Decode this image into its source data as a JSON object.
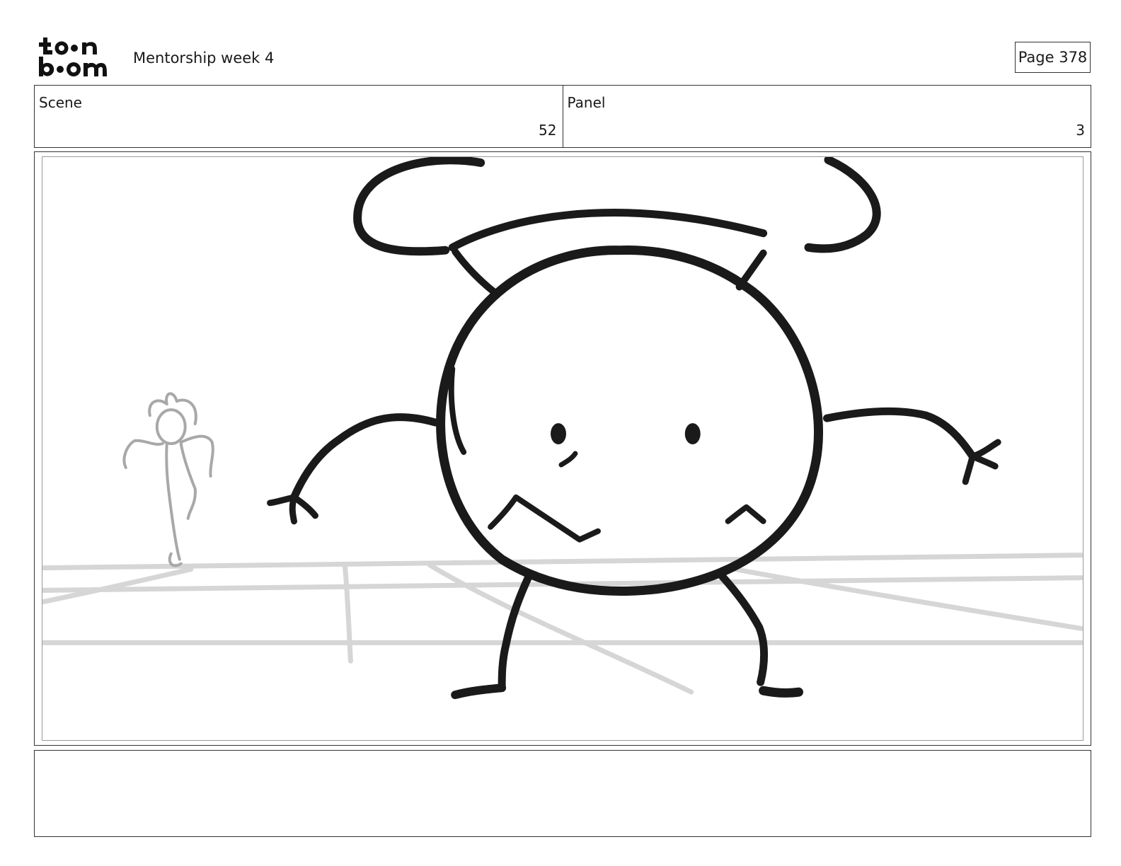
{
  "header": {
    "logo_line1": "to●n",
    "logo_line2": "b●●m",
    "project_title": "Mentorship week 4",
    "page_label": "Page 378"
  },
  "info": {
    "scene_label": "Scene",
    "scene_value": "52",
    "panel_label": "Panel",
    "panel_value": "3"
  },
  "drawing": {
    "description_icon": "storyboard-sketch",
    "ink_color": "#1a1a1a",
    "ground_color": "#d6d6d6",
    "background_character_color": "#a8a8a8"
  },
  "notes": {
    "text": ""
  }
}
